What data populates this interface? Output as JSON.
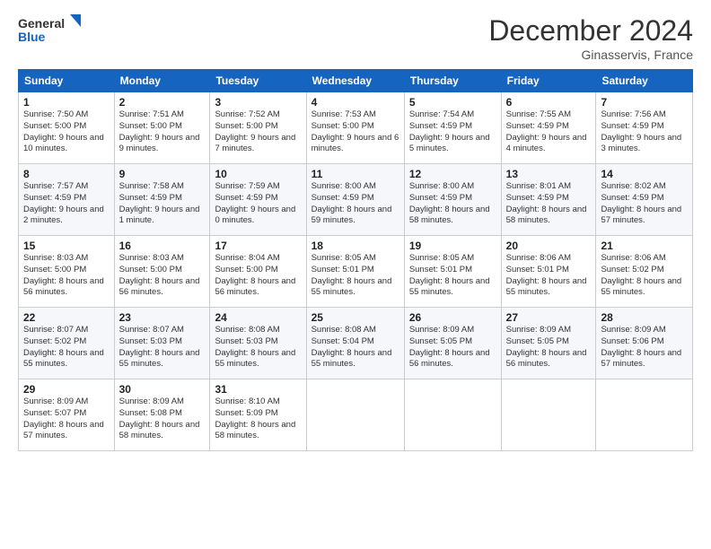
{
  "header": {
    "logo_line1": "General",
    "logo_line2": "Blue",
    "month": "December 2024",
    "location": "Ginasservis, France"
  },
  "weekdays": [
    "Sunday",
    "Monday",
    "Tuesday",
    "Wednesday",
    "Thursday",
    "Friday",
    "Saturday"
  ],
  "weeks": [
    [
      {
        "day": "1",
        "sunrise": "7:50 AM",
        "sunset": "5:00 PM",
        "daylight": "9 hours and 10 minutes."
      },
      {
        "day": "2",
        "sunrise": "7:51 AM",
        "sunset": "5:00 PM",
        "daylight": "9 hours and 9 minutes."
      },
      {
        "day": "3",
        "sunrise": "7:52 AM",
        "sunset": "5:00 PM",
        "daylight": "9 hours and 7 minutes."
      },
      {
        "day": "4",
        "sunrise": "7:53 AM",
        "sunset": "5:00 PM",
        "daylight": "9 hours and 6 minutes."
      },
      {
        "day": "5",
        "sunrise": "7:54 AM",
        "sunset": "4:59 PM",
        "daylight": "9 hours and 5 minutes."
      },
      {
        "day": "6",
        "sunrise": "7:55 AM",
        "sunset": "4:59 PM",
        "daylight": "9 hours and 4 minutes."
      },
      {
        "day": "7",
        "sunrise": "7:56 AM",
        "sunset": "4:59 PM",
        "daylight": "9 hours and 3 minutes."
      }
    ],
    [
      {
        "day": "8",
        "sunrise": "7:57 AM",
        "sunset": "4:59 PM",
        "daylight": "9 hours and 2 minutes."
      },
      {
        "day": "9",
        "sunrise": "7:58 AM",
        "sunset": "4:59 PM",
        "daylight": "9 hours and 1 minute."
      },
      {
        "day": "10",
        "sunrise": "7:59 AM",
        "sunset": "4:59 PM",
        "daylight": "9 hours and 0 minutes."
      },
      {
        "day": "11",
        "sunrise": "8:00 AM",
        "sunset": "4:59 PM",
        "daylight": "8 hours and 59 minutes."
      },
      {
        "day": "12",
        "sunrise": "8:00 AM",
        "sunset": "4:59 PM",
        "daylight": "8 hours and 58 minutes."
      },
      {
        "day": "13",
        "sunrise": "8:01 AM",
        "sunset": "4:59 PM",
        "daylight": "8 hours and 58 minutes."
      },
      {
        "day": "14",
        "sunrise": "8:02 AM",
        "sunset": "4:59 PM",
        "daylight": "8 hours and 57 minutes."
      }
    ],
    [
      {
        "day": "15",
        "sunrise": "8:03 AM",
        "sunset": "5:00 PM",
        "daylight": "8 hours and 56 minutes."
      },
      {
        "day": "16",
        "sunrise": "8:03 AM",
        "sunset": "5:00 PM",
        "daylight": "8 hours and 56 minutes."
      },
      {
        "day": "17",
        "sunrise": "8:04 AM",
        "sunset": "5:00 PM",
        "daylight": "8 hours and 56 minutes."
      },
      {
        "day": "18",
        "sunrise": "8:05 AM",
        "sunset": "5:01 PM",
        "daylight": "8 hours and 55 minutes."
      },
      {
        "day": "19",
        "sunrise": "8:05 AM",
        "sunset": "5:01 PM",
        "daylight": "8 hours and 55 minutes."
      },
      {
        "day": "20",
        "sunrise": "8:06 AM",
        "sunset": "5:01 PM",
        "daylight": "8 hours and 55 minutes."
      },
      {
        "day": "21",
        "sunrise": "8:06 AM",
        "sunset": "5:02 PM",
        "daylight": "8 hours and 55 minutes."
      }
    ],
    [
      {
        "day": "22",
        "sunrise": "8:07 AM",
        "sunset": "5:02 PM",
        "daylight": "8 hours and 55 minutes."
      },
      {
        "day": "23",
        "sunrise": "8:07 AM",
        "sunset": "5:03 PM",
        "daylight": "8 hours and 55 minutes."
      },
      {
        "day": "24",
        "sunrise": "8:08 AM",
        "sunset": "5:03 PM",
        "daylight": "8 hours and 55 minutes."
      },
      {
        "day": "25",
        "sunrise": "8:08 AM",
        "sunset": "5:04 PM",
        "daylight": "8 hours and 55 minutes."
      },
      {
        "day": "26",
        "sunrise": "8:09 AM",
        "sunset": "5:05 PM",
        "daylight": "8 hours and 56 minutes."
      },
      {
        "day": "27",
        "sunrise": "8:09 AM",
        "sunset": "5:05 PM",
        "daylight": "8 hours and 56 minutes."
      },
      {
        "day": "28",
        "sunrise": "8:09 AM",
        "sunset": "5:06 PM",
        "daylight": "8 hours and 57 minutes."
      }
    ],
    [
      {
        "day": "29",
        "sunrise": "8:09 AM",
        "sunset": "5:07 PM",
        "daylight": "8 hours and 57 minutes."
      },
      {
        "day": "30",
        "sunrise": "8:09 AM",
        "sunset": "5:08 PM",
        "daylight": "8 hours and 58 minutes."
      },
      {
        "day": "31",
        "sunrise": "8:10 AM",
        "sunset": "5:09 PM",
        "daylight": "8 hours and 58 minutes."
      },
      null,
      null,
      null,
      null
    ]
  ],
  "labels": {
    "sunrise": "Sunrise:",
    "sunset": "Sunset:",
    "daylight": "Daylight:"
  }
}
